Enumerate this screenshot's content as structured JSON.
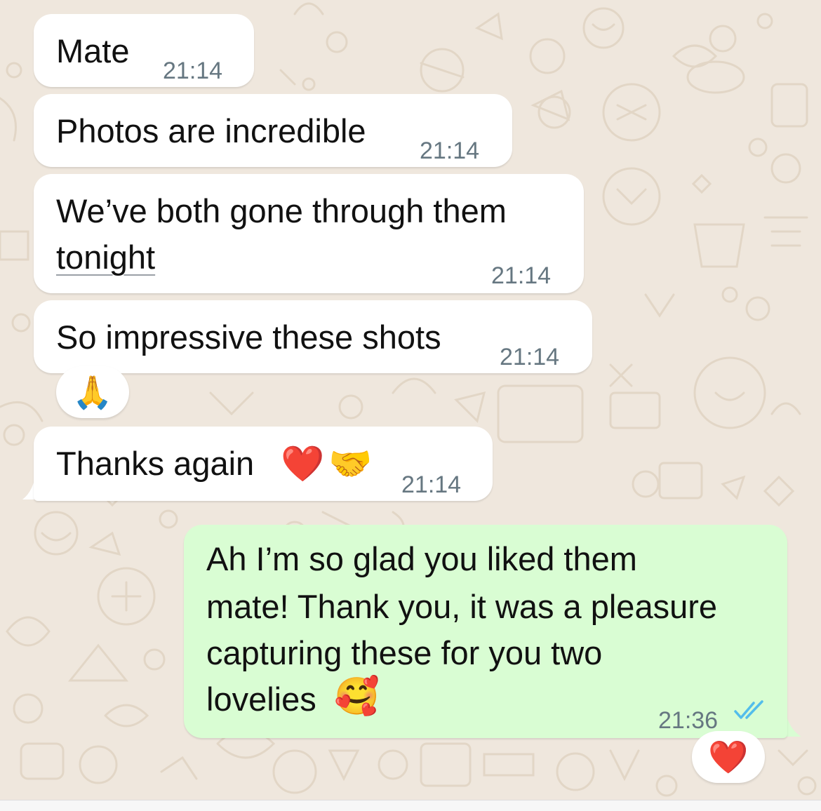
{
  "messages": [
    {
      "text": "Mate",
      "time": "21:14"
    },
    {
      "text": "Photos are incredible",
      "time": "21:14"
    },
    {
      "line1": "We’ve both gone through them",
      "line2": "tonight",
      "time": "21:14"
    },
    {
      "text": "So impressive these shots",
      "time": "21:14",
      "reaction": "🙏"
    },
    {
      "text": "Thanks again",
      "emoji1": "❤️",
      "emoji2": "🤝",
      "time": "21:14"
    }
  ],
  "reply": {
    "lines": [
      "Ah I’m so glad you liked them",
      "mate! Thank you, it was a pleasure",
      "capturing these for you two",
      "lovelies"
    ],
    "emoji": "🥰",
    "time": "21:36",
    "status_icon": "double-check-read-icon",
    "reaction": "❤️"
  },
  "colors": {
    "incoming_bubble": "#ffffff",
    "outgoing_bubble": "#d9fdd3",
    "read_tick": "#53bdeb",
    "timestamp": "#667781",
    "wallpaper": "#efe7dd"
  }
}
